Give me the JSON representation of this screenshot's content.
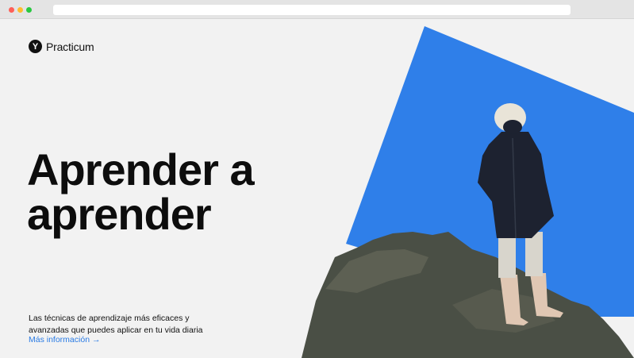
{
  "browser": {
    "window_controls": [
      "close",
      "minimize",
      "maximize"
    ]
  },
  "brand": {
    "logo_letter": "Y",
    "name": "Practicum"
  },
  "hero": {
    "title_line1": "Aprender a",
    "title_line2": "aprender",
    "description": "Las técnicas de aprendizaje más eficaces y avanzadas que puedes aplicar en tu vida diaria",
    "link_label": "Más información →"
  },
  "colors": {
    "accent_blue": "#2f7fe9",
    "link_blue": "#2a7be4",
    "page_background": "#f2f2f2",
    "rock": "#4a4f45"
  },
  "icons": [
    "practicum-logo-icon"
  ]
}
